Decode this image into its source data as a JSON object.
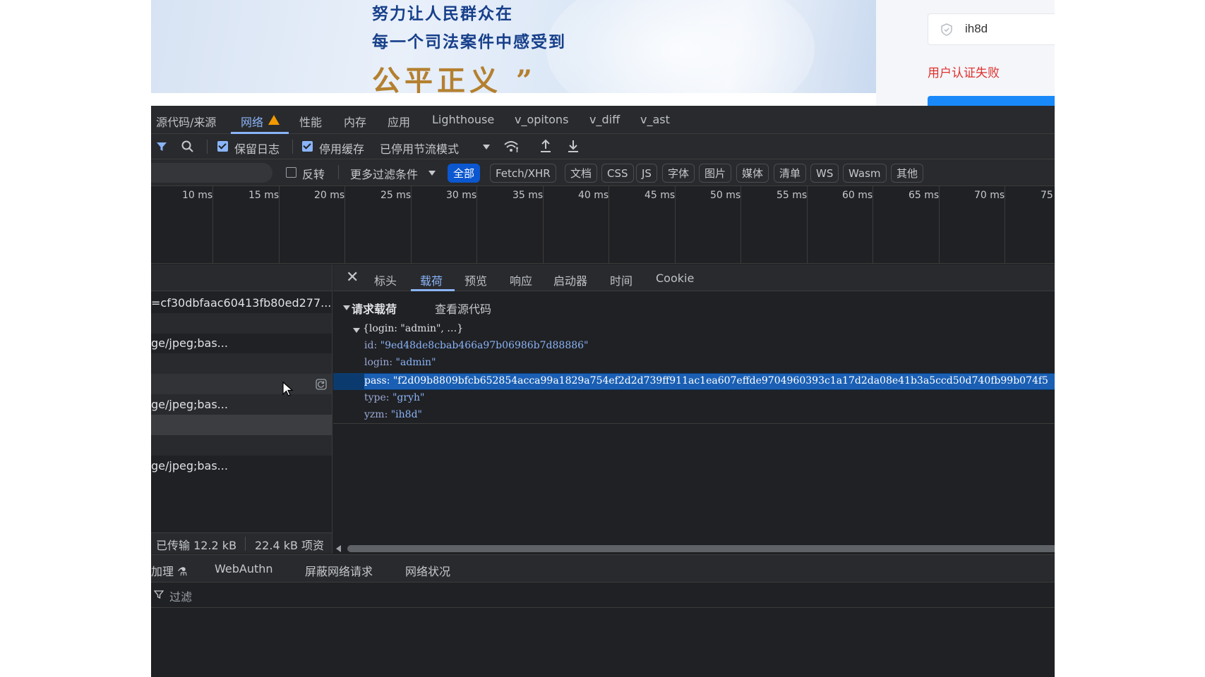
{
  "web": {
    "slogan_line1": "努力让人民群众在",
    "slogan_line2": "每一个司法案件中感受到",
    "slogan_line3": "公平正义 ”",
    "captcha_value": "ih8d",
    "auth_error": "用户认证失败"
  },
  "devtools": {
    "tabs": [
      "源代码/来源",
      "网络",
      "性能",
      "内存",
      "应用",
      "Lighthouse",
      "v_opitons",
      "v_diff",
      "v_ast"
    ],
    "active_tab": "网络",
    "toolbar": {
      "preserve_log": "保留日志",
      "disable_cache": "停用缓存",
      "throttle": "已停用节流模式"
    },
    "filterbar": {
      "invert": "反转",
      "more_filters": "更多过滤条件",
      "types": [
        "全部",
        "Fetch/XHR",
        "文档",
        "CSS",
        "JS",
        "字体",
        "图片",
        "媒体",
        "清单",
        "WS",
        "Wasm",
        "其他"
      ],
      "active_type": "全部"
    },
    "timeline_ticks": [
      "10 ms",
      "15 ms",
      "20 ms",
      "25 ms",
      "30 ms",
      "35 ms",
      "40 ms",
      "45 ms",
      "50 ms",
      "55 ms",
      "60 ms",
      "65 ms",
      "70 ms",
      "75"
    ],
    "requests": [
      "=cf30dbfaac60413fb80ed277...",
      "ge/jpeg;bas...",
      "",
      "ge/jpeg;bas...",
      "",
      "ge/jpeg;bas..."
    ],
    "status": {
      "transferred": "已传输 12.2 kB",
      "resources": "22.4 kB 项资"
    },
    "detail": {
      "close": "✕",
      "tabs": [
        "标头",
        "载荷",
        "预览",
        "响应",
        "启动器",
        "时间",
        "Cookie"
      ],
      "active_tab": "载荷",
      "section_title": "请求载荷",
      "view_source": "查看源代码",
      "summary": "{login: \"admin\", …}",
      "fields": [
        {
          "key": "id",
          "value": "\"9ed48de8cbab466a97b06986b7d88886\""
        },
        {
          "key": "login",
          "value": "\"admin\""
        },
        {
          "key": "pass",
          "value": "\"f2d09b8809bfcb652854acca99a1829a754ef2d2d739ff911ac1ea607effde9704960393c1a17d2da08e41b3a5ccd50d740fb99b074f5"
        },
        {
          "key": "type",
          "value": "\"gryh\""
        },
        {
          "key": "yzm",
          "value": "\"ih8d\""
        }
      ]
    },
    "drawer": {
      "tabs": [
        "加理 ⚗",
        "WebAuthn",
        "屏蔽网络请求",
        "网络状况"
      ],
      "filter": "过滤"
    }
  }
}
